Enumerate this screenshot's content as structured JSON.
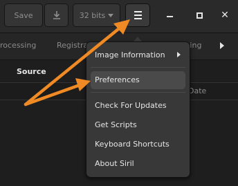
{
  "window": {
    "minimize_icon": "minimize-icon",
    "maximize_icon": "maximize-icon",
    "close_icon": "close-icon",
    "close_glyph": "✕"
  },
  "toolbar": {
    "save_label": "Save",
    "download_icon": "download-icon",
    "bits_value": "32 bits",
    "menu_icon": "hamburger-menu-icon"
  },
  "tabs": [
    {
      "label": "rocessing"
    },
    {
      "label": "Registra"
    },
    {
      "label": "cking"
    }
  ],
  "content": {
    "source_label": "Source",
    "date_column": "Date"
  },
  "menu": {
    "items": [
      {
        "label": "Image Information",
        "has_submenu": true
      },
      {
        "label": "Preferences",
        "highlighted": true
      },
      {
        "label": "Check For Updates"
      },
      {
        "label": "Get Scripts"
      },
      {
        "label": "Keyboard Shortcuts"
      },
      {
        "label": "About Siril"
      }
    ]
  },
  "colors": {
    "annotation_arrow": "#f08a24",
    "menu_background": "#383838",
    "highlight": "#4a4a4a"
  }
}
